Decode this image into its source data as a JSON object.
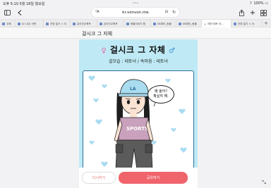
{
  "status": {
    "time": "오후 5:10",
    "date": "5월 18일 월요일",
    "battery": "100%"
  },
  "browser": {
    "url": "kr.vonvon.me",
    "tabs": [
      {
        "label": "주해"
      },
      {
        "label": "AI 시대, 어떤"
      },
      {
        "label": "관련 일기 < 이"
      },
      {
        "label": "온라인교육프"
      },
      {
        "label": "온라인교육프"
      },
      {
        "label": "동물이야기 협"
      },
      {
        "label": "SB파티_동물"
      },
      {
        "label": "SB파티_동물"
      },
      {
        "label": "예언 테토 아…"
      },
      {
        "label": "관련 일기 < 아"
      }
    ]
  },
  "page": {
    "header_title": "걸시크 그 자체",
    "result_title": "걸시크 그 자체",
    "result_subtitle": "겉모습 : 테토녀 / 속마음 : 테토녀",
    "speech_bubble": [
      "왜 울어?",
      "확실히 해."
    ],
    "shirt_text": "SPORTS",
    "cap_text": "LA"
  },
  "actions": {
    "retry_label": "다시하기",
    "share_label": "공유하기"
  },
  "colors": {
    "background": "#bfeaf5",
    "share_button": "#f0646c",
    "retry_text": "#e57373"
  }
}
